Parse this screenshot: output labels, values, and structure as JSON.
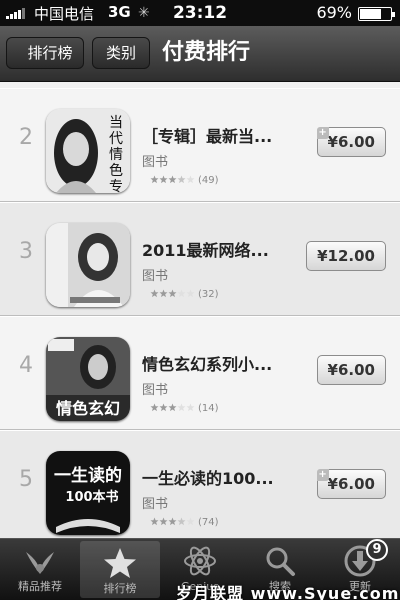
{
  "status_bar": {
    "carrier": "中国电信",
    "network": "3G",
    "time": "23:12",
    "battery": "69%",
    "battery_level": 0.69
  },
  "nav": {
    "back_label": "排行榜",
    "category_label": "类别",
    "title": "付费排行"
  },
  "apps": [
    {
      "rank": "2",
      "title": "［专辑］最新当...",
      "category": "图书",
      "reviews": "(49)",
      "price": "¥6.00",
      "rating": 3.5,
      "icon": "book-cover-woman-icon"
    },
    {
      "rank": "3",
      "title": "2011最新网络...",
      "category": "图书",
      "reviews": "(32)",
      "price": "¥12.00",
      "rating": 3.0,
      "icon": "book-cover-girl-icon"
    },
    {
      "rank": "4",
      "title": "情色玄幻系列小...",
      "category": "图书",
      "reviews": "(14)",
      "price": "¥6.00",
      "rating": 3.0,
      "icon": "book-cover-fantasy-icon"
    },
    {
      "rank": "5",
      "title": "一生必读的100...",
      "category": "图书",
      "reviews": "(74)",
      "price": "¥6.00",
      "rating": 3.5,
      "icon": "book-cover-classics-icon"
    }
  ],
  "tabs": [
    {
      "label": "精品推荐",
      "icon": "featured-icon"
    },
    {
      "label": "排行榜",
      "icon": "star-icon",
      "active": true
    },
    {
      "label": "Genius",
      "icon": "genius-atom-icon"
    },
    {
      "label": "搜索",
      "icon": "search-icon"
    },
    {
      "label": "更新",
      "icon": "download-icon",
      "badge": "9"
    }
  ],
  "watermark": "岁月联盟 www.Syue.com"
}
